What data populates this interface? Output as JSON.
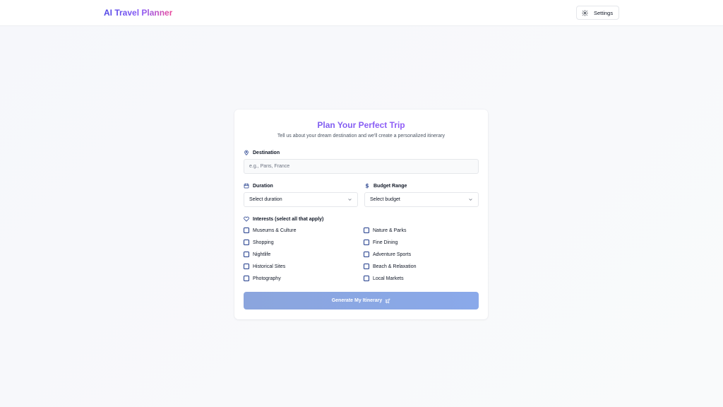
{
  "header": {
    "brand": "AI Travel Planner",
    "settings_label": "Settings",
    "settings_icon": "gear-icon"
  },
  "form": {
    "title": "Plan Your Perfect Trip",
    "subtitle": "Tell us about your dream destination and we'll create a personalized itinerary",
    "destination": {
      "label": "Destination",
      "icon": "map-pin-icon",
      "value": "",
      "placeholder": "e.g., Paris, France"
    },
    "duration": {
      "label": "Duration",
      "icon": "calendar-icon",
      "selected": "Select duration"
    },
    "budget": {
      "label": "Budget Range",
      "icon": "dollar-icon",
      "selected": "Select budget"
    },
    "interests": {
      "label": "Interests (select all that apply)",
      "icon": "heart-icon",
      "left": [
        "Museums & Culture",
        "Shopping",
        "Nightlife",
        "Historical Sites",
        "Photography"
      ],
      "right": [
        "Nature & Parks",
        "Fine Dining",
        "Adventure Sports",
        "Beach & Relaxation",
        "Local Markets"
      ]
    },
    "generate_label": "Generate My Itinerary",
    "generate_icon": "plane-icon"
  },
  "colors": {
    "brand_gradient": [
      "#4f46e5",
      "#8b5cf6",
      "#ec4899"
    ],
    "title_color": "#7c3aed",
    "button": "#8aa7e3",
    "checkbox_border": "#1e3a8a"
  }
}
